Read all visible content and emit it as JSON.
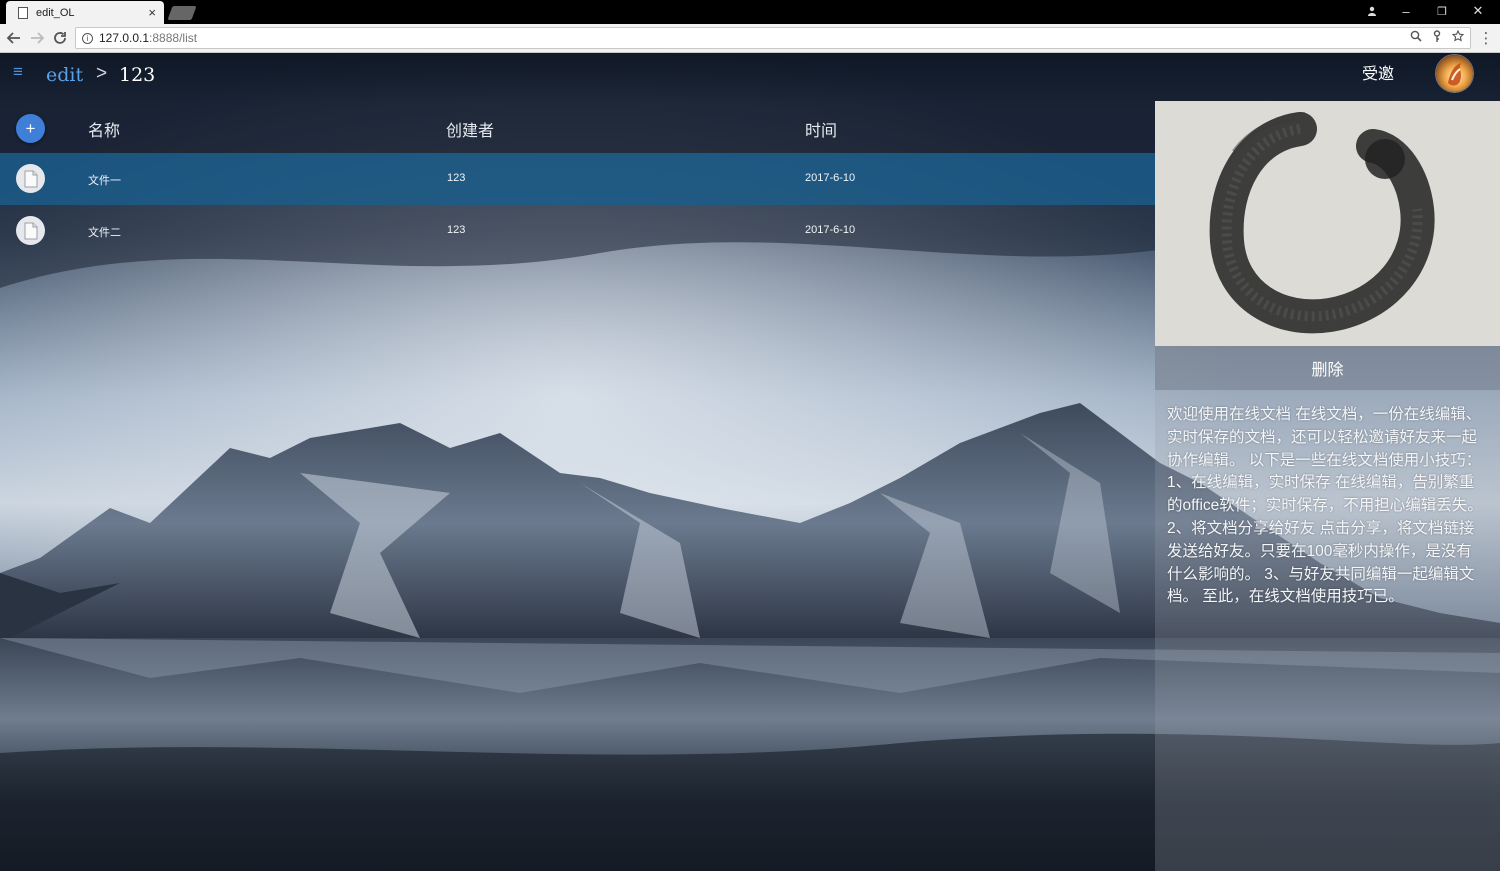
{
  "browser": {
    "tab_title": "edit_OL",
    "tab_close": "×",
    "url_host": "127.0.0.1",
    "url_path": ":8888/list",
    "icons": [
      "page-icon",
      "info-icon",
      "zoom-icon",
      "key-icon",
      "star-icon",
      "menu-icon"
    ],
    "window": {
      "minimize": "–",
      "maximize": "❐",
      "close": "✕"
    }
  },
  "header": {
    "menu_icon": "≡",
    "crumb_root": "edit",
    "crumb_separator": ">",
    "crumb_current": "123",
    "invited_label": "受邀"
  },
  "table": {
    "add_label": "+",
    "columns": [
      "名称",
      "创建者",
      "时间"
    ],
    "rows": [
      {
        "name": "文件一",
        "creator": "123",
        "time": "2017-6-10",
        "selected": true
      },
      {
        "name": "文件二",
        "creator": "123",
        "time": "2017-6-10",
        "selected": false
      }
    ]
  },
  "detail": {
    "delete_label": "删除",
    "description": "欢迎使用在线文档 在线文档，一份在线编辑、实时保存的文档，还可以轻松邀请好友来一起协作编辑。 以下是一些在线文档使用小技巧： 1、在线编辑，实时保存 在线编辑，告别繁重的office软件；实时保存，不用担心编辑丢失。 2、将文档分享给好友 点击分享，将文档链接发送给好友。只要在100毫秒内操作，是没有什么影响的。 3、与好友共同编辑一起编辑文档。 至此，在线文档使用技巧已。"
  },
  "colors": {
    "accent": "#4b8fde",
    "selected_row": "#1a5e8c",
    "add_button": "#3f7fd8"
  }
}
